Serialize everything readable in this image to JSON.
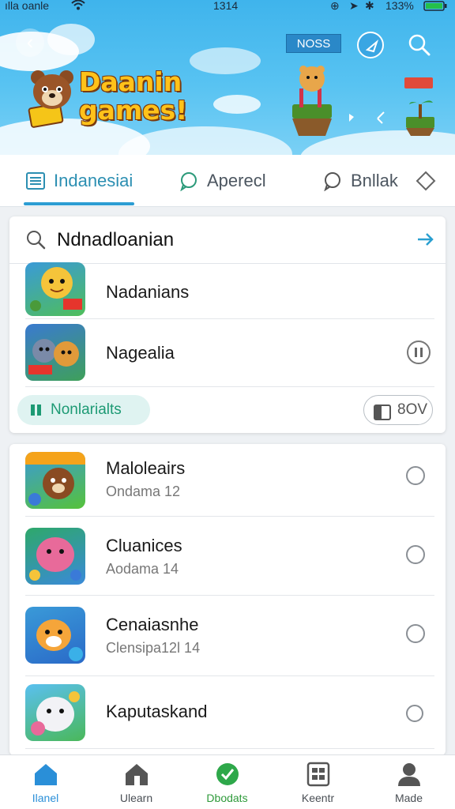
{
  "status_bar": {
    "carrier": "ılla oanle",
    "time": "1314",
    "battery": "133%"
  },
  "header": {
    "logo_line1": "Daanin",
    "logo_line2": "games!",
    "badge": "NOSS",
    "accent": "#3fb4ec"
  },
  "tabs": [
    {
      "label": "Indanesiai",
      "icon": "list-icon",
      "active": true
    },
    {
      "label": "Aperecl",
      "icon": "chat-bubble-icon",
      "active": false
    },
    {
      "label": "Bnllak",
      "icon": "chat-bubble-icon",
      "active": false
    }
  ],
  "search": {
    "value": "Ndnadloanian",
    "placeholder": ""
  },
  "top_list": [
    {
      "title": "Nadanians"
    },
    {
      "title": "Nagealia",
      "action_icon": "pause-circle-icon"
    }
  ],
  "chip": {
    "label": "Nonlarialts"
  },
  "pill_button": {
    "label": "8OV"
  },
  "game_list": [
    {
      "title": "Maloleairs",
      "subtitle": "Ondama 12"
    },
    {
      "title": "Cluanices",
      "subtitle": "Aodama 14"
    },
    {
      "title": "Cenaiasnhe",
      "subtitle": "Clensipa12l 14"
    },
    {
      "title": "Kaputaskand",
      "subtitle": ""
    }
  ],
  "bottom_nav": [
    {
      "label": "Ilanel",
      "icon": "home-icon",
      "active": true
    },
    {
      "label": "Ulearn",
      "icon": "house-icon",
      "active": false
    },
    {
      "label": "Dbodats",
      "icon": "check-circle-icon",
      "active": false
    },
    {
      "label": "Keentr",
      "icon": "grid-icon",
      "active": false
    },
    {
      "label": "Made",
      "icon": "person-icon",
      "active": false
    }
  ]
}
